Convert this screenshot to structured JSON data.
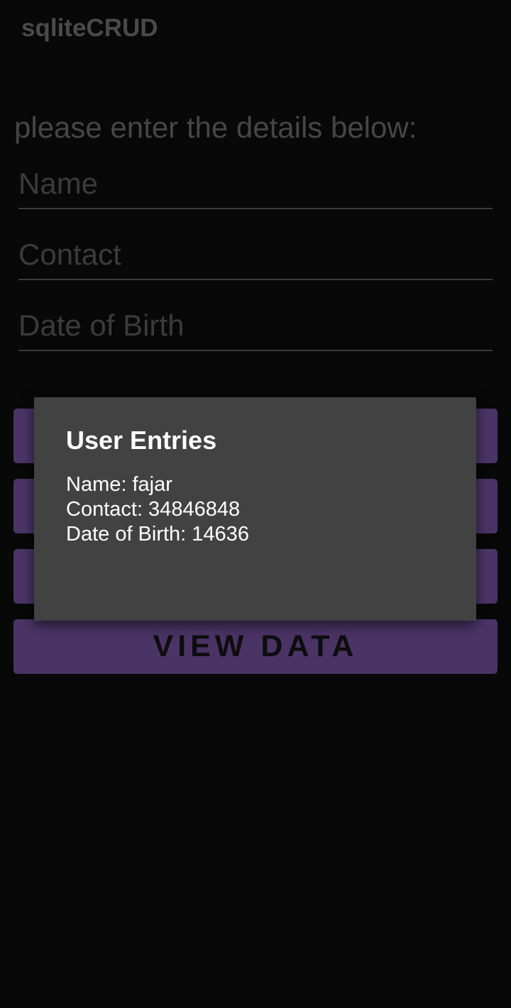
{
  "app": {
    "title": "sqliteCRUD"
  },
  "form": {
    "prompt": "please enter the details below:",
    "fields": [
      {
        "placeholder": "Name",
        "value": ""
      },
      {
        "placeholder": "Contact",
        "value": ""
      },
      {
        "placeholder": "Date of Birth",
        "value": ""
      }
    ]
  },
  "buttons": {
    "view_data": "VIEW DATA"
  },
  "dialog": {
    "title": "User Entries",
    "lines": [
      "Name: fajar",
      "Contact: 34846848",
      "Date of Birth: 14636"
    ]
  },
  "colors": {
    "background": "#080809",
    "button": "#4a3466",
    "dialog": "#424242"
  }
}
